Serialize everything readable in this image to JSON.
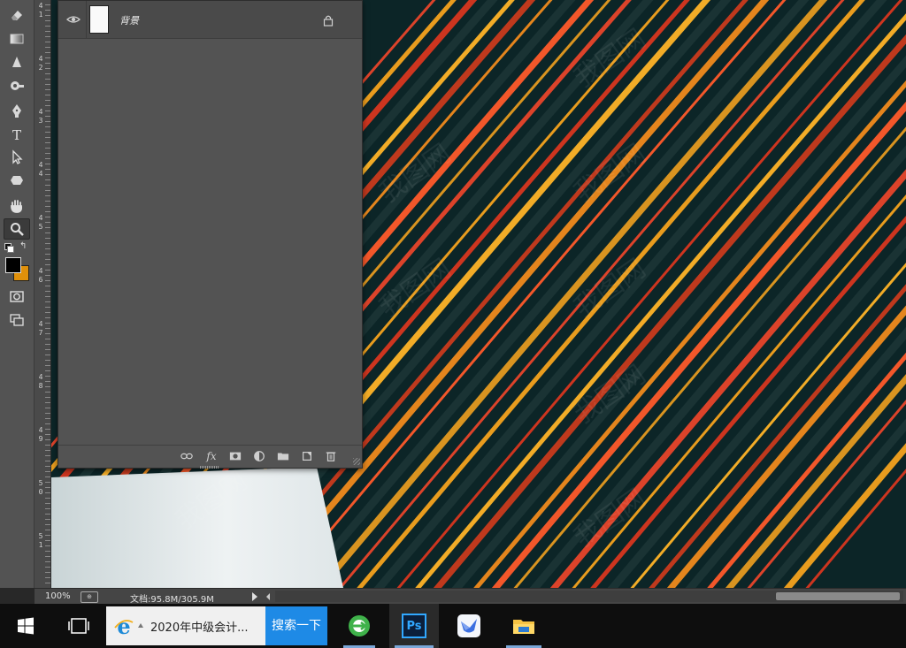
{
  "toolbar": {
    "tools": [
      "eraser-tool",
      "gradient-tool",
      "blur-tool",
      "dodge-tool",
      "pen-tool",
      "type-tool",
      "path-selection-tool",
      "shape-tool",
      "hand-tool",
      "zoom-tool"
    ],
    "foreground_color": "#000000",
    "background_color": "#e0900a"
  },
  "ruler": {
    "labels": [
      "4",
      "1",
      "4",
      "2",
      "4",
      "3",
      "4",
      "4",
      "4",
      "5",
      "4",
      "6",
      "4",
      "7",
      "4",
      "8",
      "4",
      "9",
      "5",
      "0",
      "5",
      "1"
    ]
  },
  "layers_panel": {
    "layer_name": "背景",
    "bottom_icons": [
      "link-layers-icon",
      "fx-icon",
      "add-mask-icon",
      "adjustment-layer-icon",
      "new-group-icon",
      "new-layer-icon",
      "delete-layer-icon"
    ],
    "fx_label": "fx"
  },
  "status": {
    "zoom": "100%",
    "doc_info": "文档:95.8M/305.9M"
  },
  "watermark": "我图网",
  "taskbar": {
    "search_text": "2020年中级会计...",
    "search_button": "搜索一下",
    "apps": [
      "windows-start",
      "task-view",
      "browser-ie",
      "green-browser",
      "photoshop",
      "feishu-bird",
      "file-explorer"
    ],
    "ps_label": "Ps"
  }
}
